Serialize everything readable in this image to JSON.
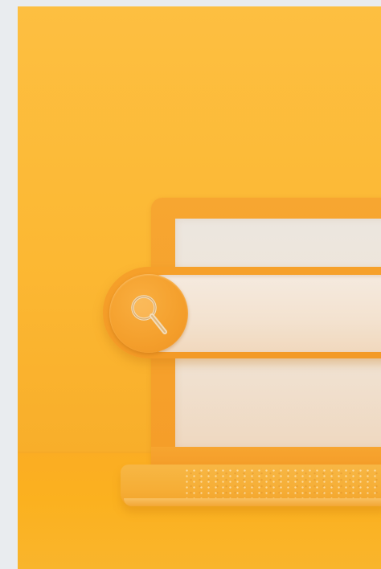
{
  "scene": {
    "subject": "",
    "colors": {
      "background": "#fcb833",
      "laptop_body": "#f59d28",
      "screen": "#ece6df",
      "search_bar_fill": "#f5eadf",
      "search_button": "#f49f2c",
      "magnifier_rim": "#e3c9a6"
    },
    "search": {
      "icon": "magnifier-icon",
      "value": "",
      "placeholder": ""
    }
  }
}
